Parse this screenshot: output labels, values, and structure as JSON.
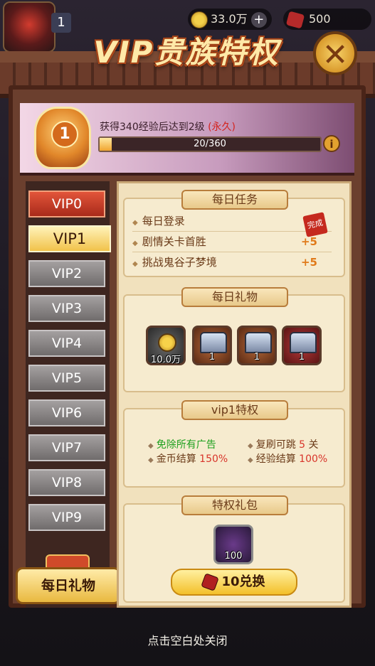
{
  "hud": {
    "level": "1",
    "coins": "33.0万",
    "gems": "500"
  },
  "dialog": {
    "title": "VIP贵族特权",
    "close_glyph": "✕"
  },
  "vip_progress": {
    "level_badge": "1",
    "hint_prefix": "获得340经验后达到2级",
    "hint_suffix": "(永久)",
    "progress_text": "20/360",
    "progress_fraction": 0.056
  },
  "sidebar": {
    "tabs": [
      "VIP0",
      "VIP1",
      "VIP2",
      "VIP3",
      "VIP4",
      "VIP5",
      "VIP6",
      "VIP7",
      "VIP8",
      "VIP9"
    ],
    "selected": "VIP1",
    "daily_gift_label": "每日礼物"
  },
  "daily_tasks": {
    "title": "每日任务",
    "rows": [
      {
        "label": "每日登录",
        "reward": "",
        "stamp": "完成"
      },
      {
        "label": "剧情关卡首胜",
        "reward": "+5"
      },
      {
        "label": "挑战鬼谷子梦境",
        "reward": "+5"
      }
    ]
  },
  "daily_gifts": {
    "title": "每日礼物",
    "items": [
      {
        "icon": "coin-icon",
        "count": "10.0万"
      },
      {
        "icon": "silver-chest-icon",
        "count": "1"
      },
      {
        "icon": "silver-chest-icon",
        "count": "1"
      },
      {
        "icon": "silver-chest-icon",
        "count": "1"
      }
    ]
  },
  "perks": {
    "title": "vip1特权",
    "no_ads": "免除所有广告",
    "skip_label": "复刷可跳",
    "skip_value": "5",
    "skip_unit": "关",
    "gold_label": "金币结算",
    "gold_value": "150%",
    "exp_label": "经验结算",
    "exp_value": "100%"
  },
  "privilege_pack": {
    "title": "特权礼包",
    "item_count": "100",
    "exchange_label": "10兑换"
  },
  "footer": {
    "close_hint": "点击空白处关闭"
  }
}
